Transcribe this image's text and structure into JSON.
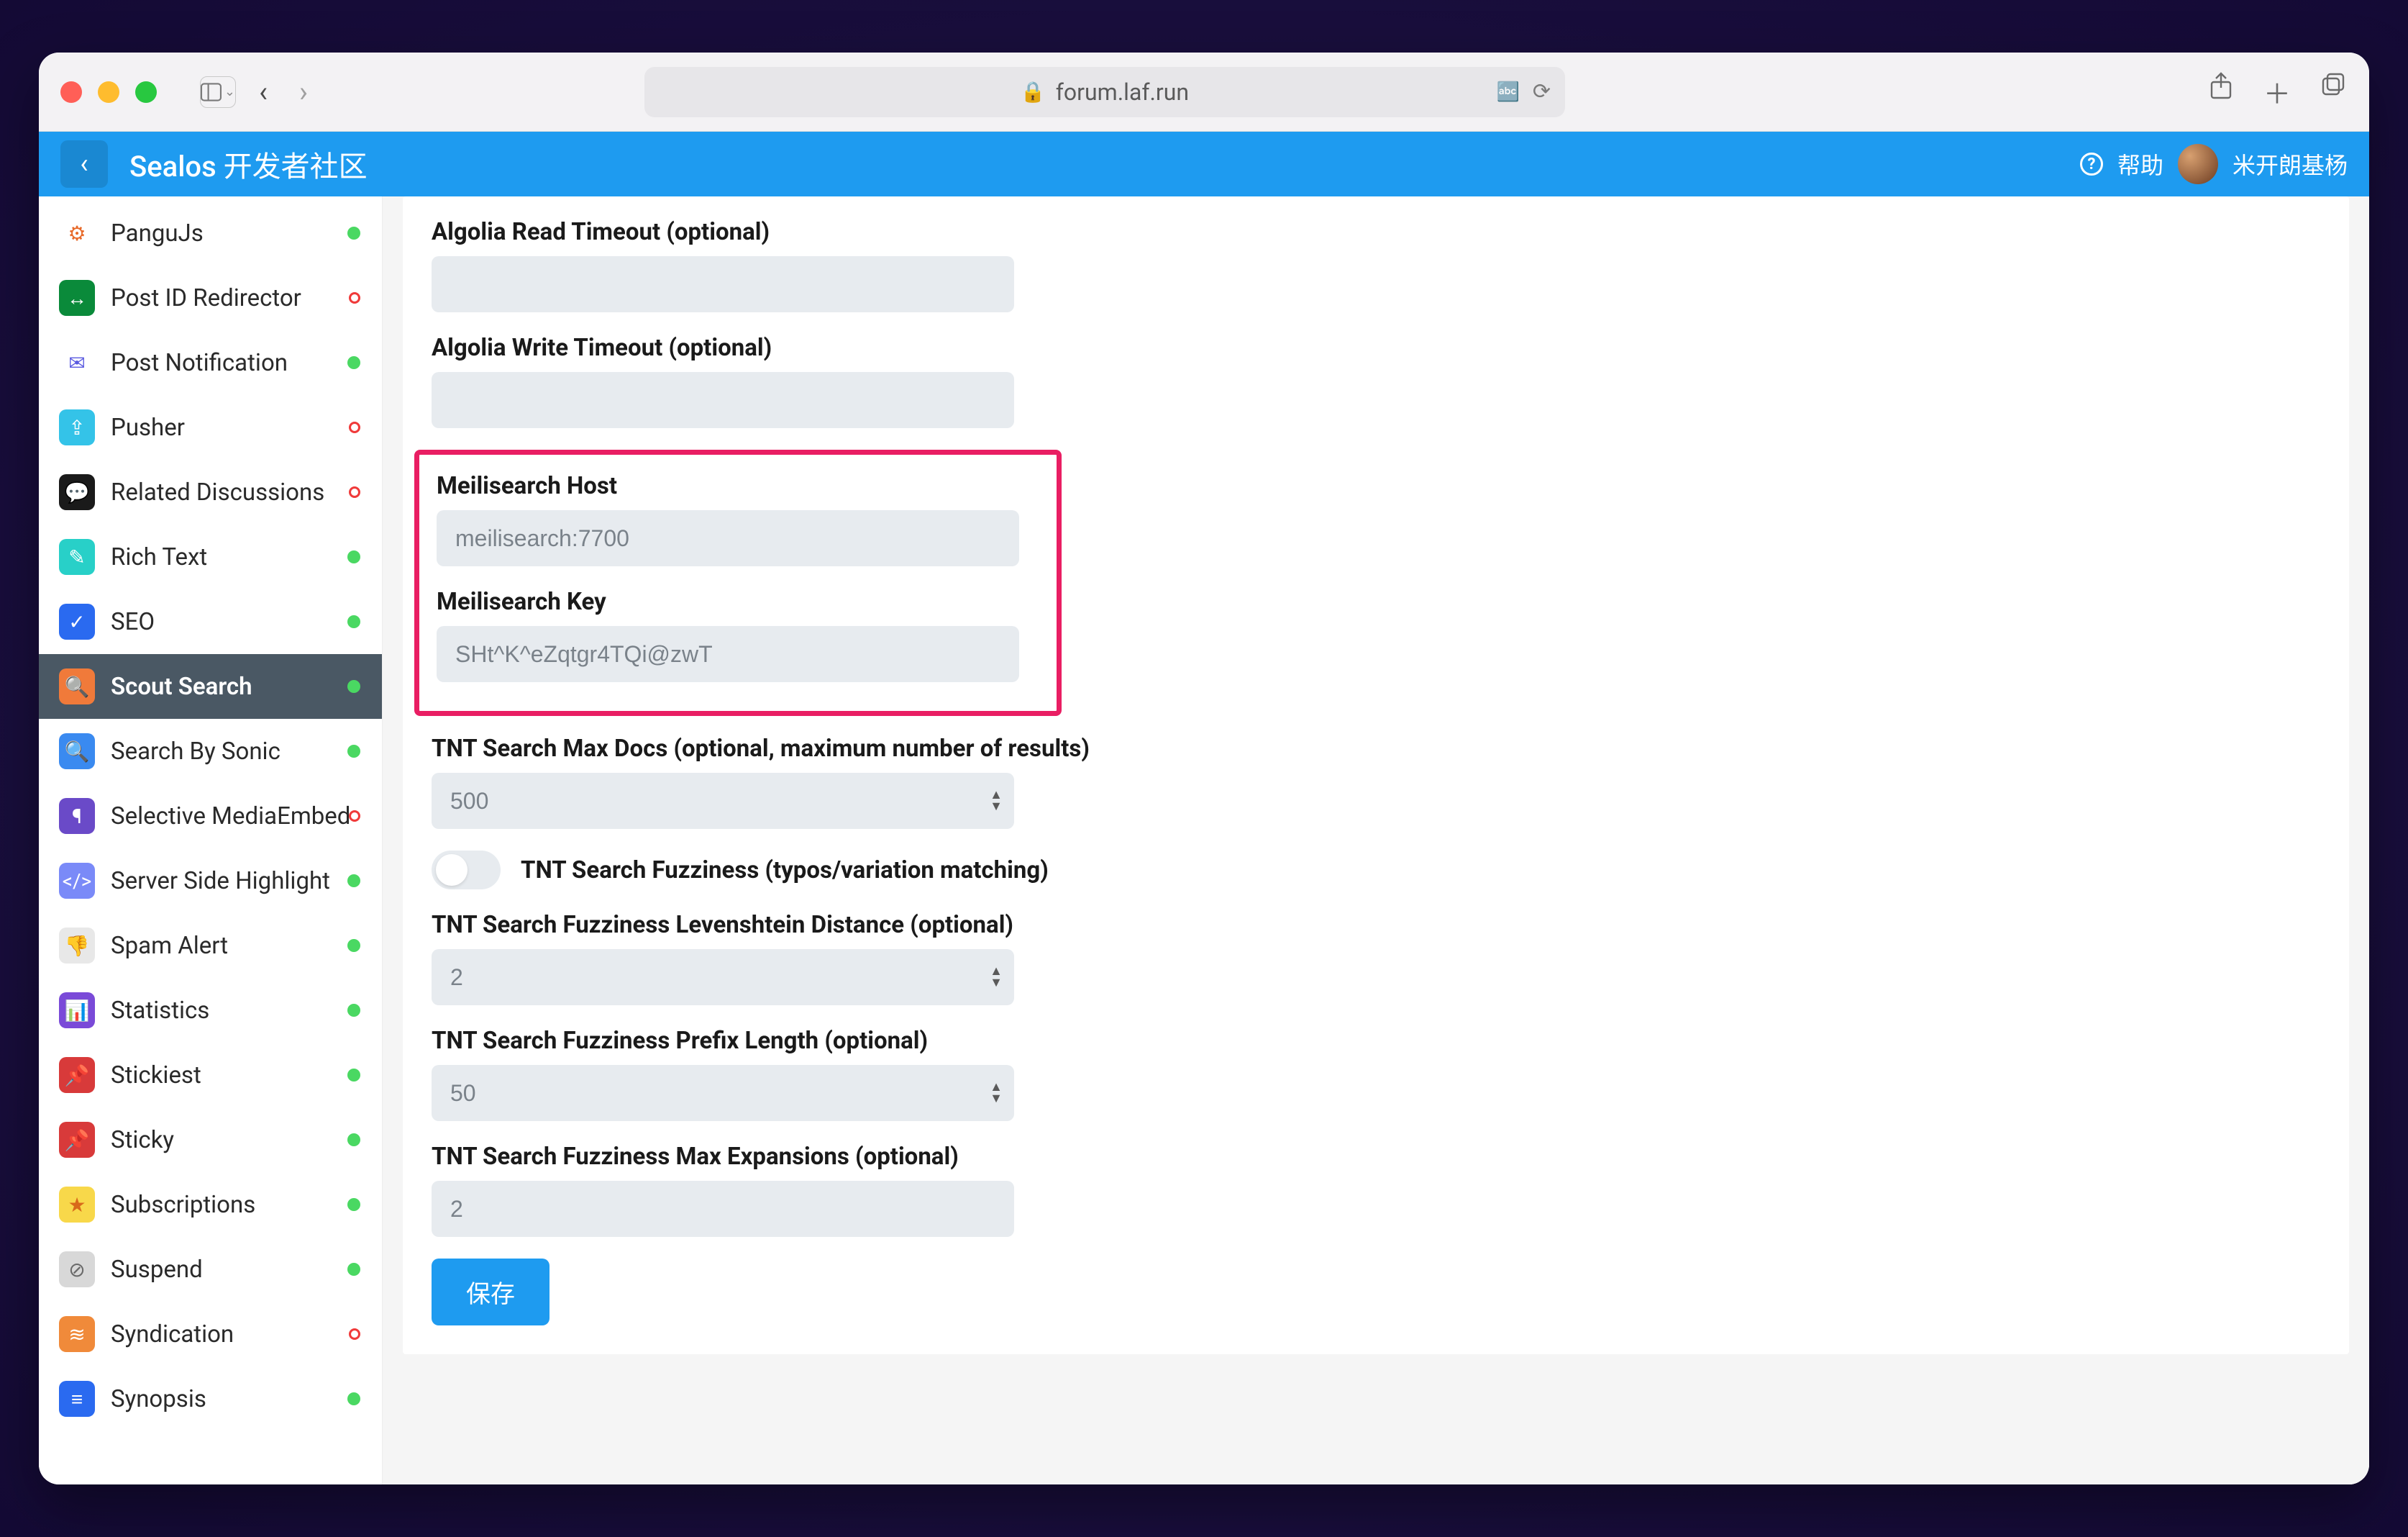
{
  "chrome": {
    "url": "forum.laf.run"
  },
  "header": {
    "title": "Sealos 开发者社区",
    "help_label": "帮助",
    "username": "米开朗基杨"
  },
  "sidebar": {
    "items": [
      {
        "label": "PanguJs",
        "icon_bg": "#ffffff",
        "icon_fg": "#e86a2a",
        "glyph": "⚙",
        "status": "green",
        "icon_name": "pangujs-icon"
      },
      {
        "label": "Post ID Redirector",
        "icon_bg": "#0a8a3a",
        "icon_fg": "#ffffff",
        "glyph": "↔",
        "status": "red",
        "icon_name": "redirect-icon"
      },
      {
        "label": "Post Notification",
        "icon_bg": "#ffffff",
        "icon_fg": "#5a5ae0",
        "glyph": "✉",
        "status": "green",
        "icon_name": "notification-icon"
      },
      {
        "label": "Pusher",
        "icon_bg": "#34c3e8",
        "icon_fg": "#ffffff",
        "glyph": "⇪",
        "status": "red",
        "icon_name": "pusher-icon"
      },
      {
        "label": "Related Discussions",
        "icon_bg": "#1a1a1a",
        "icon_fg": "#ffffff",
        "glyph": "💬",
        "status": "red",
        "icon_name": "discussion-icon"
      },
      {
        "label": "Rich Text",
        "icon_bg": "#28d0c8",
        "icon_fg": "#ffffff",
        "glyph": "✎",
        "status": "green",
        "icon_name": "richtext-icon"
      },
      {
        "label": "SEO",
        "icon_bg": "#2a6af0",
        "icon_fg": "#ffffff",
        "glyph": "✓",
        "status": "green",
        "icon_name": "seo-icon"
      },
      {
        "label": "Scout Search",
        "icon_bg": "#f07a3a",
        "icon_fg": "#ffffff",
        "glyph": "🔍",
        "status": "green",
        "icon_name": "search-icon",
        "active": true
      },
      {
        "label": "Search By Sonic",
        "icon_bg": "#3a8af0",
        "icon_fg": "#ffffff",
        "glyph": "🔍",
        "status": "green",
        "icon_name": "sonic-icon"
      },
      {
        "label": "Selective MediaEmbed",
        "icon_bg": "#6a4ac8",
        "icon_fg": "#ffffff",
        "glyph": "¶",
        "status": "red",
        "icon_name": "mediaembed-icon"
      },
      {
        "label": "Server Side Highlight",
        "icon_bg": "#7a8af8",
        "icon_fg": "#ffffff",
        "glyph": "</>",
        "status": "green",
        "icon_name": "highlight-icon"
      },
      {
        "label": "Spam Alert",
        "icon_bg": "#e8e8e8",
        "icon_fg": "#6a6a6a",
        "glyph": "👎",
        "status": "green",
        "icon_name": "spam-icon"
      },
      {
        "label": "Statistics",
        "icon_bg": "#7a4ad8",
        "icon_fg": "#ffffff",
        "glyph": "📊",
        "status": "green",
        "icon_name": "statistics-icon"
      },
      {
        "label": "Stickiest",
        "icon_bg": "#d83a3a",
        "icon_fg": "#ffffff",
        "glyph": "📌",
        "status": "green",
        "icon_name": "stickiest-icon"
      },
      {
        "label": "Sticky",
        "icon_bg": "#d83a3a",
        "icon_fg": "#ffffff",
        "glyph": "📌",
        "status": "green",
        "icon_name": "sticky-icon"
      },
      {
        "label": "Subscriptions",
        "icon_bg": "#f8d84a",
        "icon_fg": "#d86a1a",
        "glyph": "★",
        "status": "green",
        "icon_name": "subscriptions-icon"
      },
      {
        "label": "Suspend",
        "icon_bg": "#d8d8d8",
        "icon_fg": "#6a6a6a",
        "glyph": "⊘",
        "status": "green",
        "icon_name": "suspend-icon"
      },
      {
        "label": "Syndication",
        "icon_bg": "#f08a3a",
        "icon_fg": "#ffffff",
        "glyph": "≋",
        "status": "red",
        "icon_name": "rss-icon"
      },
      {
        "label": "Synopsis",
        "icon_bg": "#2a6af0",
        "icon_fg": "#ffffff",
        "glyph": "≡",
        "status": "green",
        "icon_name": "synopsis-icon"
      }
    ]
  },
  "form": {
    "algolia_read_label": "Algolia Read Timeout (optional)",
    "algolia_read_value": "",
    "algolia_write_label": "Algolia Write Timeout (optional)",
    "algolia_write_value": "",
    "meili_host_label": "Meilisearch Host",
    "meili_host_value": "meilisearch:7700",
    "meili_key_label": "Meilisearch Key",
    "meili_key_value": "SHt^K^eZqtgr4TQi@zwT",
    "tnt_maxdocs_label": "TNT Search Max Docs (optional, maximum number of results)",
    "tnt_maxdocs_value": "500",
    "tnt_fuzz_label": "TNT Search Fuzziness (typos/variation matching)",
    "tnt_leven_label": "TNT Search Fuzziness Levenshtein Distance (optional)",
    "tnt_leven_value": "2",
    "tnt_prefix_label": "TNT Search Fuzziness Prefix Length (optional)",
    "tnt_prefix_value": "50",
    "tnt_maxexp_label": "TNT Search Fuzziness Max Expansions (optional)",
    "tnt_maxexp_value": "2",
    "save_label": "保存"
  }
}
